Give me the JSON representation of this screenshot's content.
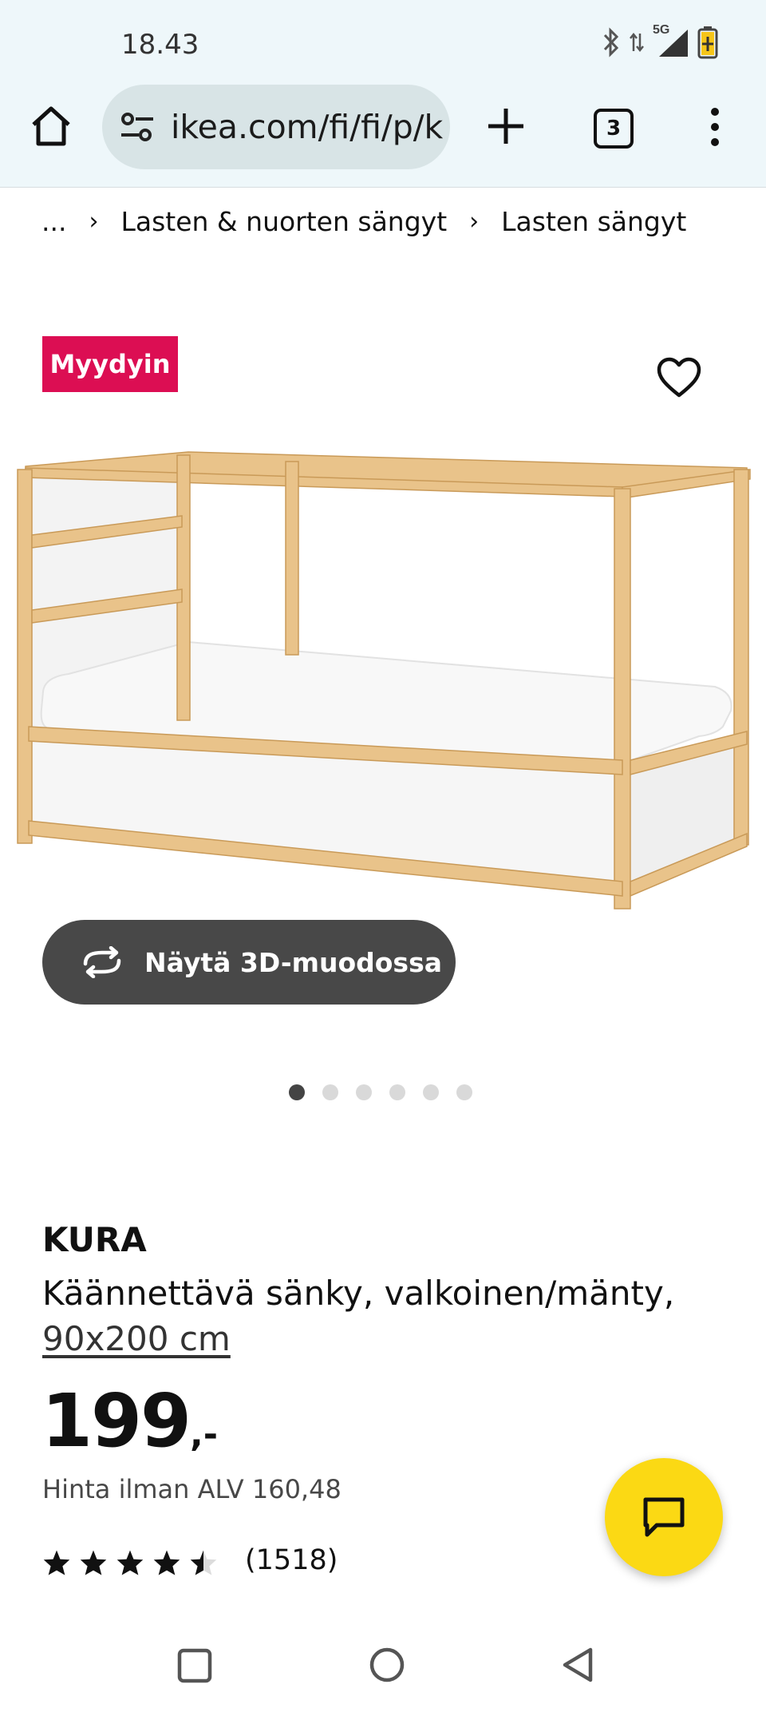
{
  "status_bar": {
    "time": "18.43",
    "network": "5G"
  },
  "browser": {
    "url": "ikea.com/fi/fi/p/k",
    "tab_count": "3"
  },
  "breadcrumb": {
    "ellipsis": "...",
    "items": [
      "Lasten & nuorten sängyt",
      "Lasten sängyt"
    ]
  },
  "product": {
    "badge": "Myydyin",
    "view_3d_label": "Näytä 3D-muodossa",
    "image_count": 6,
    "active_image": 1,
    "name": "KURA",
    "description": "Käännettävä sänky, valkoinen/mänty,",
    "size": "90x200 cm",
    "price": "199",
    "price_suffix": ",-",
    "vat_text": "Hinta ilman ALV 160,48",
    "rating": 4.5,
    "reviews": "(1518)"
  },
  "colors": {
    "badge": "#dc0e53",
    "chat_button": "#fbd914",
    "button_dark": "#484848",
    "chrome_bg": "#eef7fa"
  }
}
